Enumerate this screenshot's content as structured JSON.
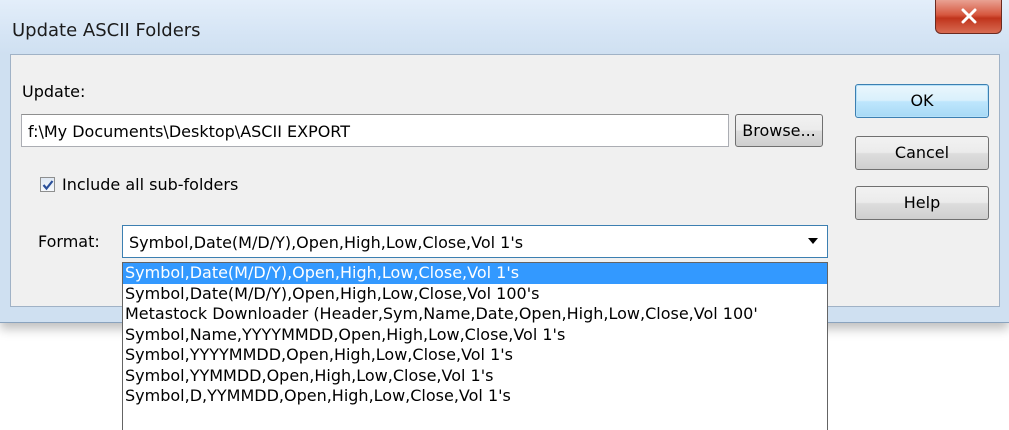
{
  "window": {
    "title": "Update ASCII Folders"
  },
  "update": {
    "label": "Update:",
    "path": "f:\\My Documents\\Desktop\\ASCII EXPORT",
    "browse_label": "Browse..."
  },
  "checkbox": {
    "label": "Include all sub-folders",
    "checked": true
  },
  "format": {
    "label": "Format:",
    "selected": "Symbol,Date(M/D/Y),Open,High,Low,Close,Vol 1's",
    "options": [
      "Symbol,Date(M/D/Y),Open,High,Low,Close,Vol 1's",
      "Symbol,Date(M/D/Y),Open,High,Low,Close,Vol 100's",
      "Metastock Downloader (Header,Sym,Name,Date,Open,High,Low,Close,Vol 100'",
      "Symbol,Name,YYYYMMDD,Open,High,Low,Close,Vol 1's",
      "Symbol,YYYYMMDD,Open,High,Low,Close,Vol 1's",
      "Symbol,YYMMDD,Open,High,Low,Close,Vol 1's",
      "Symbol,D,YYMMDD,Open,High,Low,Close,Vol 1's"
    ]
  },
  "buttons": {
    "ok": "OK",
    "cancel": "Cancel",
    "help": "Help"
  }
}
